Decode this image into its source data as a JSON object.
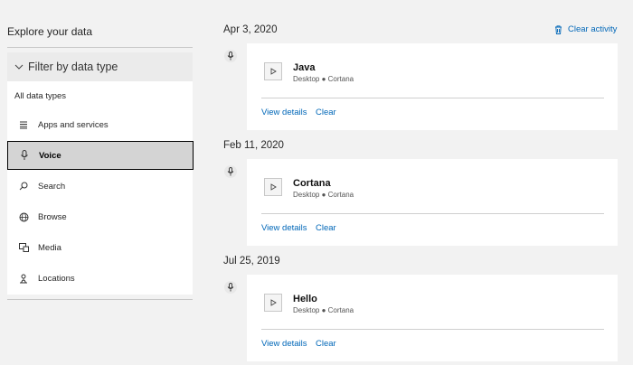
{
  "sidebar": {
    "title": "Explore your data",
    "filter_label": "Filter by data type",
    "all_types": "All data types",
    "items": [
      {
        "label": "Apps and services",
        "icon": "list-icon"
      },
      {
        "label": "Voice",
        "icon": "microphone-icon",
        "selected": true
      },
      {
        "label": "Search",
        "icon": "search-icon"
      },
      {
        "label": "Browse",
        "icon": "globe-icon"
      },
      {
        "label": "Media",
        "icon": "media-icon"
      },
      {
        "label": "Locations",
        "icon": "location-icon"
      }
    ]
  },
  "main": {
    "clear_activity": "Clear activity",
    "groups": [
      {
        "date": "Apr 3, 2020",
        "title": "Java",
        "device": "Desktop",
        "app": "Cortana",
        "view_details": "View details",
        "clear": "Clear"
      },
      {
        "date": "Feb 11, 2020",
        "title": "Cortana",
        "device": "Desktop",
        "app": "Cortana",
        "view_details": "View details",
        "clear": "Clear"
      },
      {
        "date": "Jul 25, 2019",
        "title": "Hello",
        "device": "Desktop",
        "app": "Cortana",
        "view_details": "View details",
        "clear": "Clear"
      }
    ]
  },
  "colors": {
    "accent": "#0067b8",
    "background": "#f2f2f2",
    "selected": "#d4d4d4"
  }
}
